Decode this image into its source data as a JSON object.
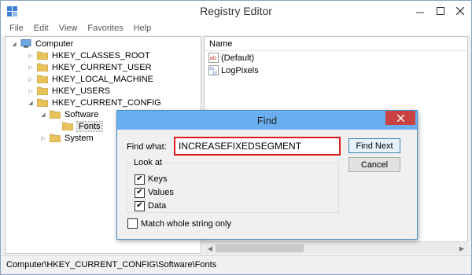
{
  "window": {
    "title": "Registry Editor"
  },
  "menu": [
    "File",
    "Edit",
    "View",
    "Favorites",
    "Help"
  ],
  "tree": {
    "root": "Computer",
    "hkey_classes_root": "HKEY_CLASSES_ROOT",
    "hkey_current_user": "HKEY_CURRENT_USER",
    "hkey_local_machine": "HKEY_LOCAL_MACHINE",
    "hkey_users": "HKEY_USERS",
    "hkey_current_config": "HKEY_CURRENT_CONFIG",
    "software": "Software",
    "fonts": "Fonts",
    "system": "System"
  },
  "list": {
    "column_name": "Name",
    "rows": [
      "(Default)",
      "LogPixels"
    ]
  },
  "status": {
    "path": "Computer\\HKEY_CURRENT_CONFIG\\Software\\Fonts"
  },
  "find_dialog": {
    "title": "Find",
    "find_what_label": "Find what:",
    "find_what_value": "INCREASEFIXEDSEGMENT",
    "find_next_label": "Find Next",
    "cancel_label": "Cancel",
    "look_at_label": "Look at",
    "keys_label": "Keys",
    "keys_checked": true,
    "values_label": "Values",
    "values_checked": true,
    "data_label": "Data",
    "data_checked": true,
    "match_whole_label": "Match whole string only",
    "match_whole_checked": false
  },
  "colors": {
    "dialog_title_bg": "#6aaef0",
    "dialog_close_bg": "#c94242",
    "input_highlight": "#dc1c1c",
    "folder": "#e8c25a"
  },
  "icons": [
    "regedit-icon",
    "minimize-icon",
    "maximize-icon",
    "close-icon",
    "computer-icon",
    "folder-icon",
    "string-value-icon",
    "binary-value-icon",
    "check-icon"
  ]
}
